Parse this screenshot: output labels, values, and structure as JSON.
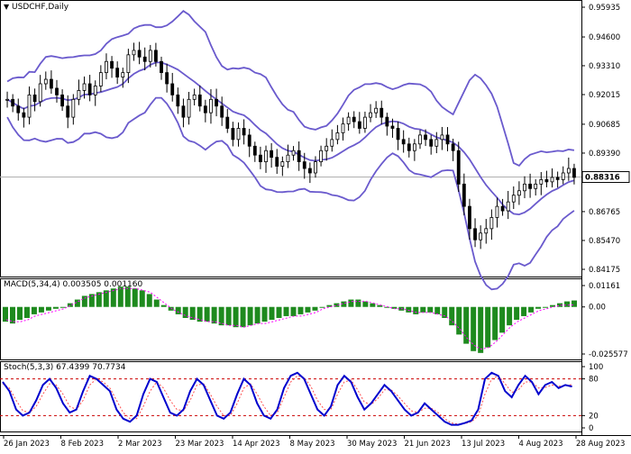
{
  "window": {
    "symbol_title": "USDCHF,Daily",
    "menu_icon": "triangle-down-icon"
  },
  "price": {
    "axis_labels": [
      "0.95935",
      "0.94600",
      "0.93310",
      "0.92015",
      "0.90685",
      "0.89390",
      "0.88316",
      "0.86765",
      "0.85470",
      "0.84175"
    ],
    "current_price": "0.88316",
    "colors": {
      "bands": "#6a5acd",
      "candles": "#000000",
      "price_line": "#b0b0b0"
    }
  },
  "macd": {
    "label": "MACD(5,34,4) 0.003505 0.001160",
    "axis_labels": [
      "0.01161",
      "0.00",
      "-0.025577"
    ],
    "colors": {
      "histogram": "#1e8a1e",
      "signal": "#ff00ff"
    }
  },
  "stoch": {
    "label": "Stoch(5,3,3) 67.4399 70.7734",
    "axis_labels": [
      "100",
      "80",
      "20",
      "0"
    ],
    "colors": {
      "main": "#0000cd",
      "signal": "#ff4d4d",
      "levels": "#cc0000"
    }
  },
  "time_axis": [
    "26 Jan 2023",
    "8 Feb 2023",
    "2 Mar 2023",
    "23 Mar 2023",
    "14 Apr 2023",
    "8 May 2023",
    "30 May 2023",
    "21 Jun 2023",
    "13 Jul 2023",
    "4 Aug 2023",
    "28 Aug 2023"
  ],
  "chart_data": [
    {
      "type": "candlestick",
      "title": "USDCHF,Daily",
      "indicator": "Bollinger Bands",
      "ylim": [
        0.84175,
        0.95935
      ],
      "last_value": 0.88316,
      "close_approx": [
        0.918,
        0.915,
        0.912,
        0.91,
        0.92,
        0.917,
        0.925,
        0.927,
        0.923,
        0.92,
        0.915,
        0.91,
        0.918,
        0.922,
        0.925,
        0.92,
        0.924,
        0.93,
        0.935,
        0.932,
        0.928,
        0.93,
        0.938,
        0.94,
        0.937,
        0.935,
        0.94,
        0.935,
        0.93,
        0.925,
        0.92,
        0.915,
        0.91,
        0.918,
        0.92,
        0.915,
        0.912,
        0.918,
        0.915,
        0.91,
        0.905,
        0.9,
        0.905,
        0.902,
        0.897,
        0.893,
        0.89,
        0.895,
        0.892,
        0.888,
        0.89,
        0.893,
        0.895,
        0.89,
        0.887,
        0.885,
        0.89,
        0.895,
        0.897,
        0.9,
        0.903,
        0.907,
        0.91,
        0.908,
        0.905,
        0.91,
        0.912,
        0.914,
        0.91,
        0.906,
        0.905,
        0.9,
        0.898,
        0.895,
        0.898,
        0.902,
        0.9,
        0.897,
        0.9,
        0.902,
        0.898,
        0.895,
        0.88,
        0.87,
        0.86,
        0.855,
        0.858,
        0.86,
        0.865,
        0.87,
        0.868,
        0.872,
        0.875,
        0.877,
        0.88,
        0.878,
        0.88,
        0.882,
        0.881,
        0.883,
        0.882,
        0.885,
        0.887,
        0.883
      ]
    },
    {
      "type": "bar",
      "title": "MACD(5,34,4)",
      "series": [
        {
          "name": "MACD",
          "values": [
            -0.008,
            -0.009,
            -0.007,
            -0.006,
            -0.004,
            -0.003,
            -0.002,
            -0.001,
            0.0,
            0.002,
            0.004,
            0.006,
            0.007,
            0.008,
            0.009,
            0.01,
            0.011,
            0.011,
            0.01,
            0.009,
            0.007,
            0.004,
            0.001,
            -0.002,
            -0.004,
            -0.006,
            -0.007,
            -0.008,
            -0.008,
            -0.009,
            -0.01,
            -0.01,
            -0.011,
            -0.011,
            -0.01,
            -0.009,
            -0.008,
            -0.007,
            -0.006,
            -0.005,
            -0.005,
            -0.004,
            -0.003,
            -0.002,
            0.0,
            0.001,
            0.002,
            0.003,
            0.004,
            0.004,
            0.003,
            0.002,
            0.001,
            0.0,
            -0.001,
            -0.002,
            -0.003,
            -0.004,
            -0.003,
            -0.003,
            -0.004,
            -0.006,
            -0.01,
            -0.015,
            -0.02,
            -0.024,
            -0.025,
            -0.022,
            -0.018,
            -0.014,
            -0.01,
            -0.007,
            -0.005,
            -0.003,
            -0.001,
            0.0,
            0.001,
            0.002,
            0.003,
            0.003505
          ]
        },
        {
          "name": "Signal",
          "values": [
            -0.007,
            -0.008,
            -0.008,
            -0.007,
            -0.005,
            -0.004,
            -0.003,
            -0.002,
            -0.001,
            0.001,
            0.003,
            0.005,
            0.006,
            0.007,
            0.008,
            0.009,
            0.01,
            0.01,
            0.01,
            0.009,
            0.008,
            0.005,
            0.002,
            -0.001,
            -0.003,
            -0.005,
            -0.006,
            -0.007,
            -0.008,
            -0.008,
            -0.009,
            -0.01,
            -0.01,
            -0.011,
            -0.01,
            -0.009,
            -0.009,
            -0.008,
            -0.007,
            -0.006,
            -0.005,
            -0.005,
            -0.004,
            -0.003,
            -0.001,
            0.0,
            0.001,
            0.002,
            0.003,
            0.003,
            0.003,
            0.002,
            0.001,
            0.0,
            -0.001,
            -0.001,
            -0.002,
            -0.003,
            -0.003,
            -0.003,
            -0.004,
            -0.005,
            -0.008,
            -0.012,
            -0.017,
            -0.021,
            -0.023,
            -0.022,
            -0.019,
            -0.015,
            -0.011,
            -0.008,
            -0.006,
            -0.004,
            -0.002,
            -0.001,
            0.0,
            0.001,
            0.001,
            0.00116
          ]
        }
      ],
      "ylim": [
        -0.025577,
        0.01161
      ]
    },
    {
      "type": "line",
      "title": "Stoch(5,3,3)",
      "series": [
        {
          "name": "Main",
          "values": [
            75,
            60,
            30,
            20,
            25,
            45,
            70,
            80,
            65,
            40,
            25,
            30,
            60,
            85,
            80,
            70,
            60,
            30,
            15,
            10,
            20,
            55,
            80,
            75,
            50,
            25,
            20,
            30,
            60,
            80,
            70,
            45,
            20,
            15,
            25,
            55,
            80,
            70,
            40,
            20,
            15,
            30,
            65,
            85,
            90,
            80,
            55,
            30,
            20,
            35,
            70,
            85,
            75,
            50,
            30,
            40,
            55,
            70,
            60,
            45,
            30,
            20,
            25,
            40,
            30,
            20,
            10,
            5,
            5,
            8,
            12,
            30,
            80,
            90,
            85,
            60,
            50,
            70,
            85,
            75,
            55,
            70,
            75,
            65,
            70,
            67.4399
          ]
        },
        {
          "name": "Signal",
          "values": [
            72,
            65,
            45,
            28,
            25,
            35,
            55,
            72,
            70,
            55,
            35,
            30,
            45,
            70,
            80,
            75,
            65,
            45,
            25,
            15,
            15,
            35,
            60,
            75,
            65,
            45,
            30,
            28,
            45,
            70,
            72,
            55,
            35,
            20,
            20,
            40,
            65,
            72,
            55,
            35,
            20,
            25,
            50,
            75,
            85,
            82,
            68,
            45,
            30,
            30,
            55,
            75,
            78,
            62,
            42,
            38,
            48,
            62,
            62,
            52,
            40,
            28,
            25,
            32,
            32,
            25,
            15,
            8,
            6,
            7,
            10,
            20,
            55,
            80,
            85,
            72,
            58,
            62,
            75,
            75,
            65,
            66,
            70,
            68,
            69,
            70.7734
          ]
        }
      ],
      "levels": [
        20,
        80
      ],
      "ylim": [
        0,
        100
      ]
    }
  ]
}
